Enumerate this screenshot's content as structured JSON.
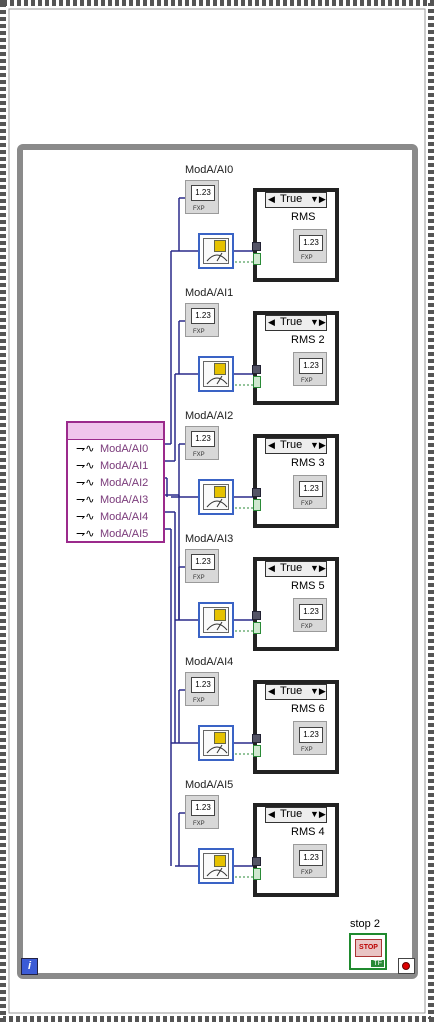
{
  "loop": {
    "iteration_terminal": "i",
    "stop_label": "stop 2",
    "stop_button_text": "STOP",
    "stop_button_tag": "TF"
  },
  "cluster": {
    "channels": [
      "ModA/AI0",
      "ModA/AI1",
      "ModA/AI2",
      "ModA/AI3",
      "ModA/AI4",
      "ModA/AI5"
    ]
  },
  "rows": [
    {
      "label": "ModA/AI0",
      "case_value": "True",
      "rms_label": "RMS"
    },
    {
      "label": "ModA/AI1",
      "case_value": "True",
      "rms_label": "RMS 2"
    },
    {
      "label": "ModA/AI2",
      "case_value": "True",
      "rms_label": "RMS 3"
    },
    {
      "label": "ModA/AI3",
      "case_value": "True",
      "rms_label": "RMS 5"
    },
    {
      "label": "ModA/AI4",
      "case_value": "True",
      "rms_label": "RMS 6"
    },
    {
      "label": "ModA/AI5",
      "case_value": "True",
      "rms_label": "RMS 4"
    }
  ],
  "indicator": {
    "display": "1.23",
    "type": "FXP"
  },
  "colors": {
    "loop_frame": "#8a8a8a",
    "cluster": "#9b2a8c",
    "wire": "#2a2a8a",
    "express_vi": "#3a63c5",
    "stop": "#1f8a2e"
  }
}
